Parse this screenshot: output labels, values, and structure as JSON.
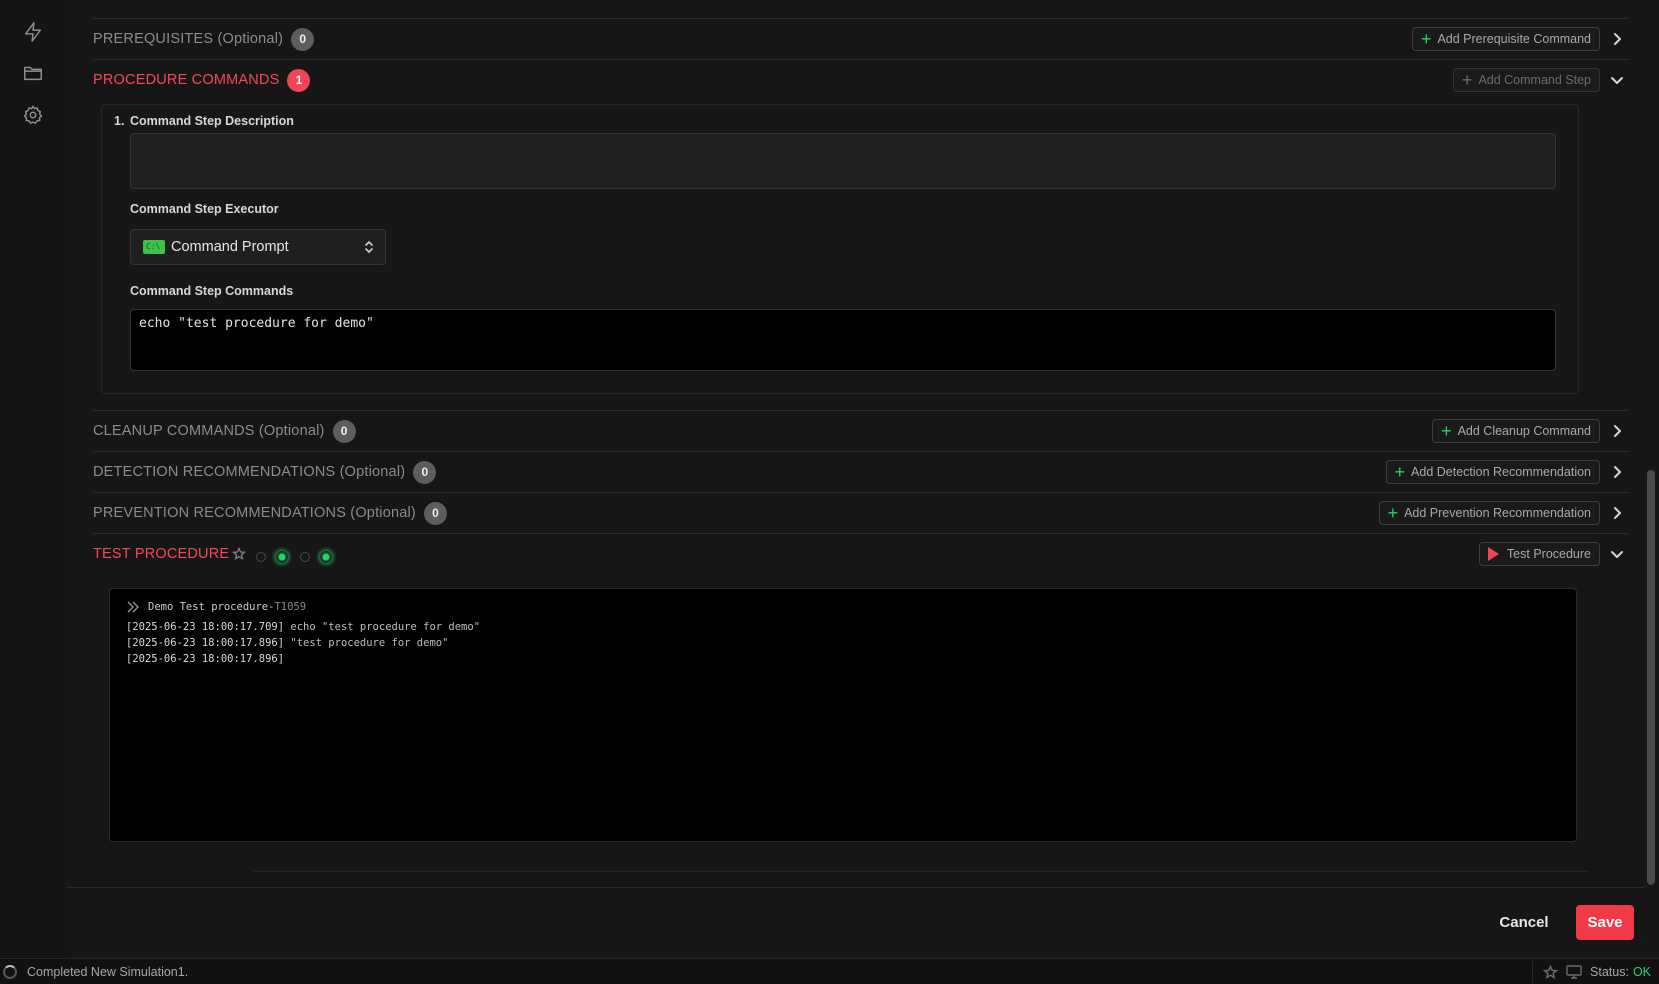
{
  "rail": {
    "icons": [
      "lightning-icon",
      "folder-icon",
      "gear-icon"
    ]
  },
  "sections": {
    "prerequisites": {
      "title": "PREREQUISITES",
      "optional": "(Optional)",
      "count": "0",
      "button": "Add Prerequisite Command"
    },
    "procedure": {
      "title": "PROCEDURE COMMANDS",
      "count": "1",
      "button": "Add Command Step"
    },
    "cleanup": {
      "title": "CLEANUP COMMANDS",
      "optional": "(Optional)",
      "count": "0",
      "button": "Add Cleanup Command"
    },
    "detection": {
      "title": "DETECTION RECOMMENDATIONS",
      "optional": "(Optional)",
      "count": "0",
      "button": "Add Detection Recommendation"
    },
    "prevention": {
      "title": "PREVENTION RECOMMENDATIONS",
      "optional": "(Optional)",
      "count": "0",
      "button": "Add Prevention Recommendation"
    },
    "test": {
      "title": "TEST PROCEDURE",
      "button": "Test Procedure"
    }
  },
  "step": {
    "number": "1.",
    "description_label": "Command Step Description",
    "description_value": "",
    "executor_label": "Command Step Executor",
    "executor_value": "Command Prompt",
    "executor_icon_text": "C:\\",
    "commands_label": "Command Step Commands",
    "commands_value": "echo \"test procedure for demo\""
  },
  "terminal": {
    "title": "Demo Test procedure",
    "separator": " - ",
    "technique_id": "T1059",
    "lines": [
      {
        "ts": "[2025-06-23 18:00:17.709]",
        "text": "echo \"test procedure for demo\""
      },
      {
        "ts": "[2025-06-23 18:00:17.896]",
        "text": "\"test procedure for demo\""
      },
      {
        "ts": "[2025-06-23 18:00:17.896]",
        "text": ""
      }
    ]
  },
  "footer": {
    "cancel": "Cancel",
    "save": "Save"
  },
  "statusbar": {
    "message": "Completed New Simulation1.",
    "status_label": "Status:",
    "status_value": "OK"
  },
  "colors": {
    "accent_red": "#f04557",
    "ok_green": "#2fd36c",
    "save_red": "#f03a48"
  }
}
